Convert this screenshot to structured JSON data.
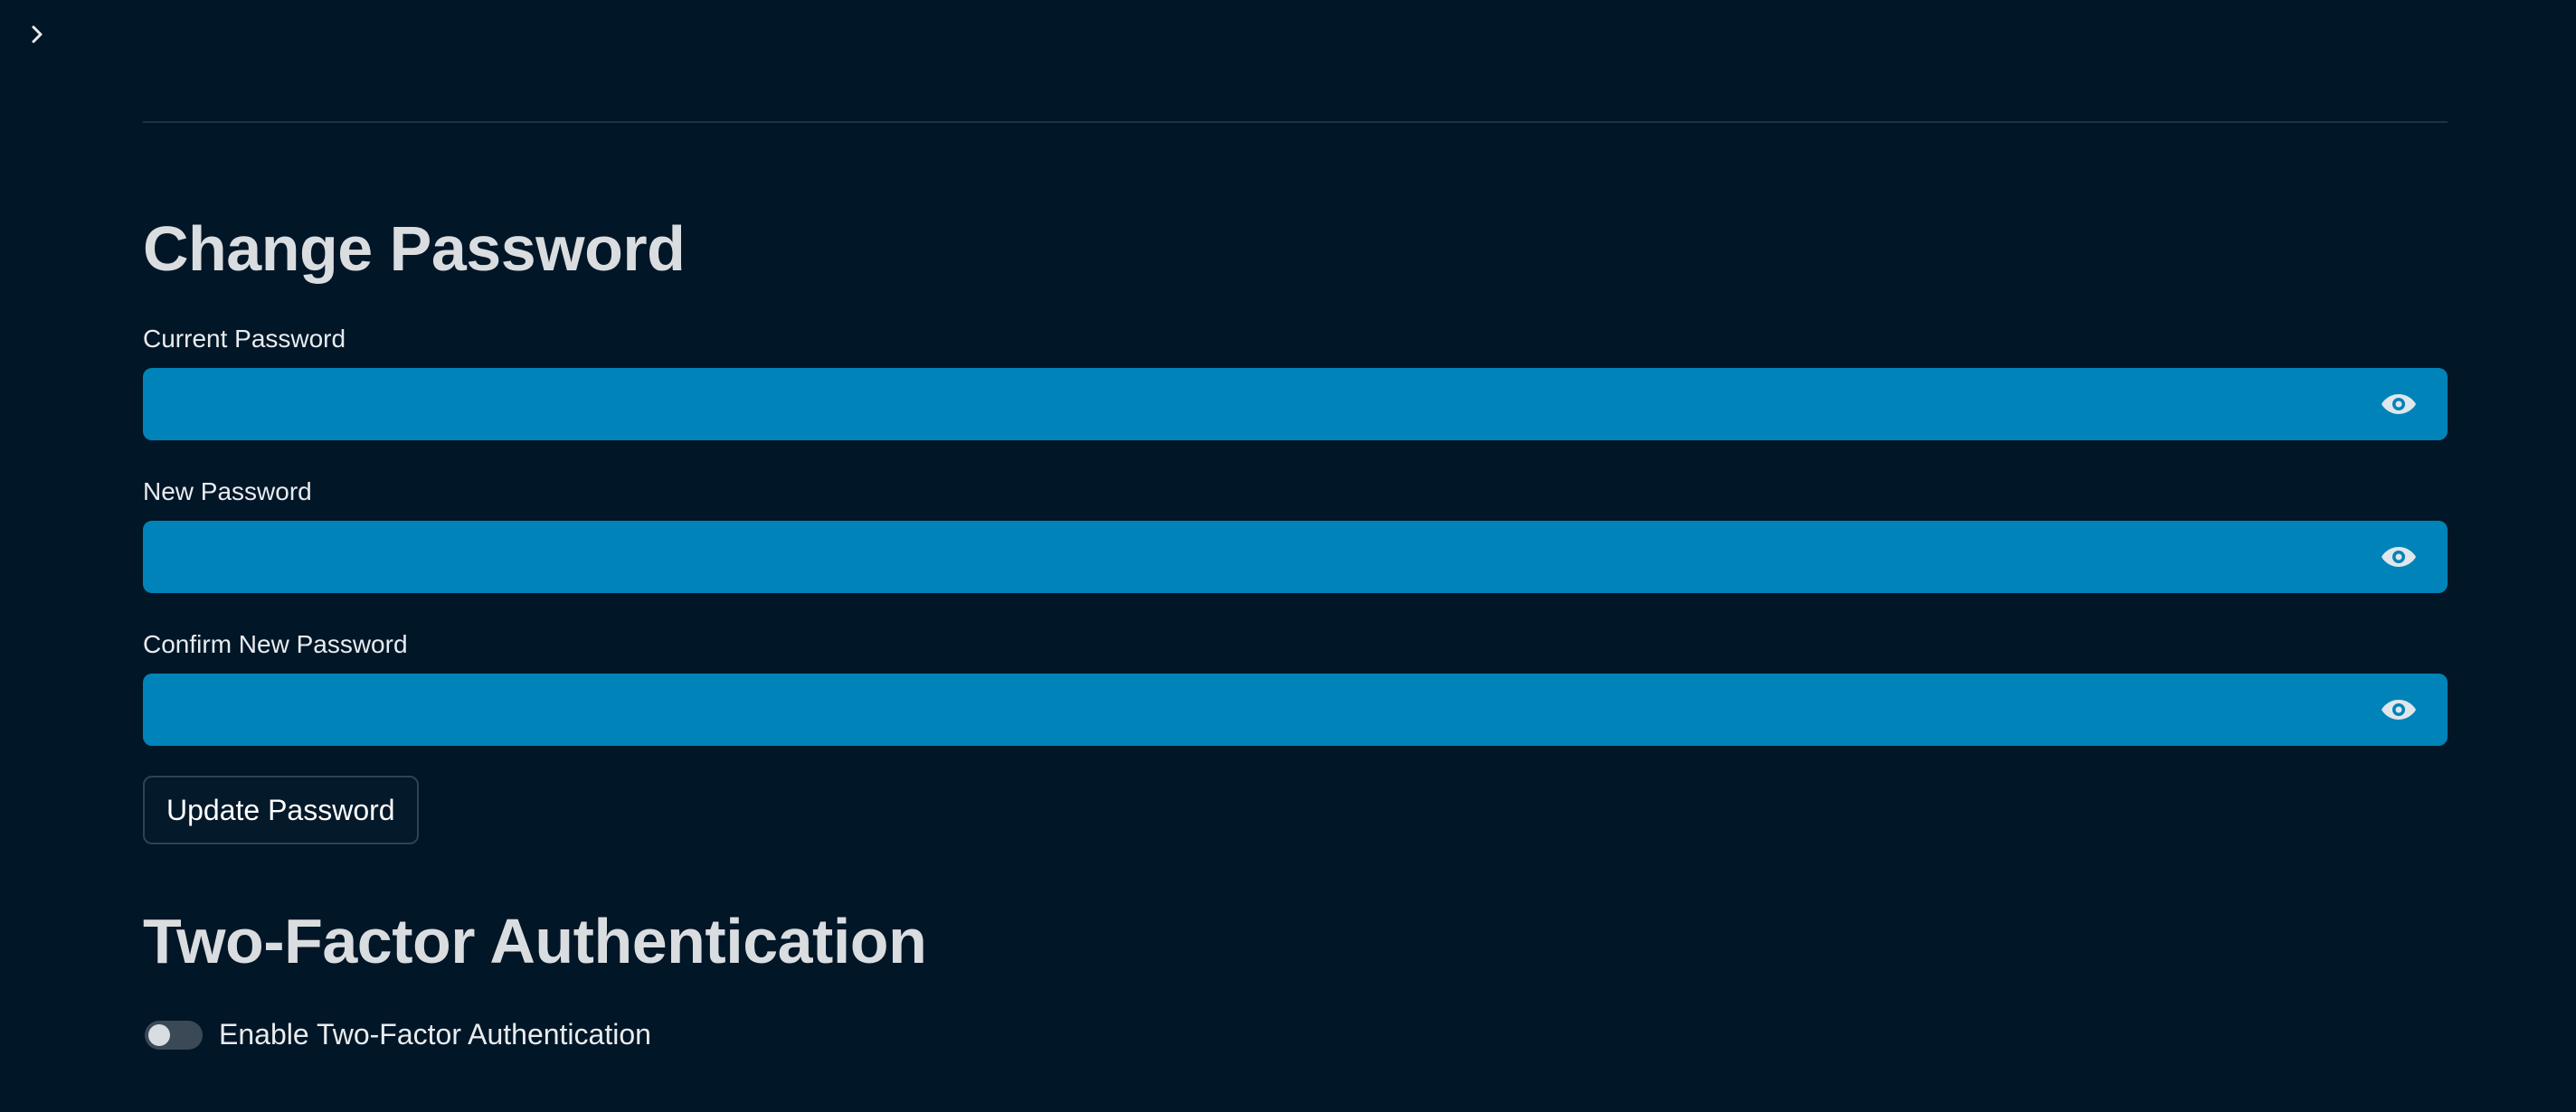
{
  "sidebar": {
    "toggle_icon": "chevron-right-icon"
  },
  "change_password": {
    "title": "Change Password",
    "fields": [
      {
        "label": "Current Password",
        "value": "",
        "icon": "eye-icon"
      },
      {
        "label": "New Password",
        "value": "",
        "icon": "eye-icon"
      },
      {
        "label": "Confirm New Password",
        "value": "",
        "icon": "eye-icon"
      }
    ],
    "submit_label": "Update Password"
  },
  "two_factor": {
    "title": "Two-Factor Authentication",
    "toggle_label": "Enable Two-Factor Authentication",
    "enabled": false
  },
  "colors": {
    "background": "#011627",
    "input_fill": "#0083b8",
    "text": "#e8ecef"
  }
}
